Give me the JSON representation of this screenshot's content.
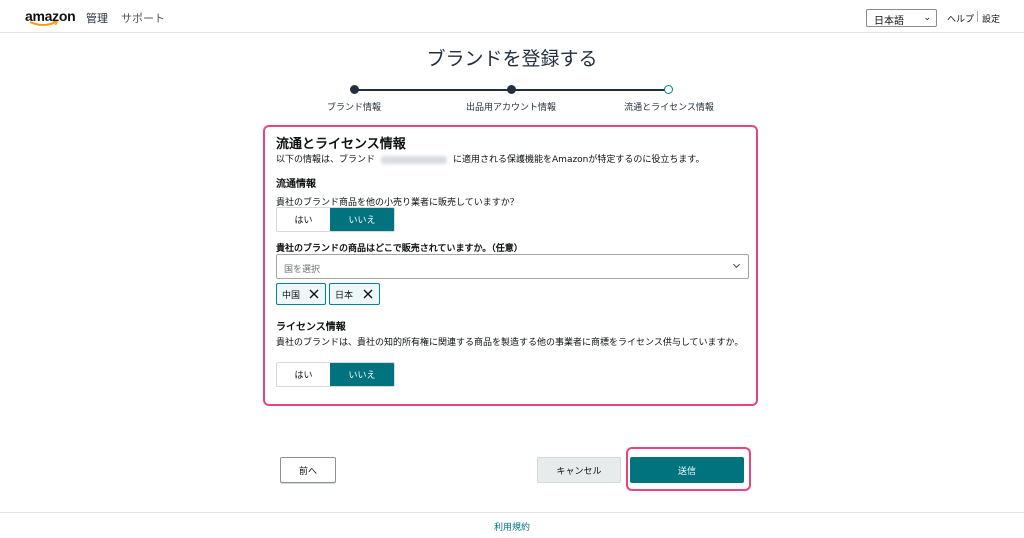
{
  "header": {
    "logo": "amazon",
    "nav": [
      "管理",
      "サポート"
    ],
    "language": "日本語",
    "help": "ヘルプ",
    "settings": "設定"
  },
  "page": {
    "title": "ブランドを登録する",
    "steps": [
      "ブランド情報",
      "出品用アカウント情報",
      "流通とライセンス情報"
    ],
    "current_step": 3
  },
  "form": {
    "section_title": "流通とライセンス情報",
    "description_before": "以下の情報は、ブランド",
    "description_after": "に適用される保護機能をAmazonが特定するのに役立ちます。",
    "distribution": {
      "heading": "流通情報",
      "question": "貴社のブランド商品を他の小売り業者に販売していますか？",
      "yes": "はい",
      "no": "いいえ",
      "selected": "いいえ"
    },
    "countries": {
      "question": "貴社のブランドの商品はどこで販売されていますか。（任意）",
      "placeholder": "国を選択",
      "selected": [
        "中国",
        "日本"
      ]
    },
    "license": {
      "heading": "ライセンス情報",
      "question": "貴社のブランドは、貴社の知的所有権に関連する商品を製造する他の事業者に商標をライセンス供与していますか。",
      "yes": "はい",
      "no": "いいえ",
      "selected": "いいえ"
    }
  },
  "buttons": {
    "prev": "前へ",
    "cancel": "キャンセル",
    "submit": "送信"
  },
  "footer": {
    "terms": "利用規約"
  },
  "colors": {
    "accent": "#00737f",
    "highlight": "#e8457a",
    "text": "#0f1111"
  }
}
